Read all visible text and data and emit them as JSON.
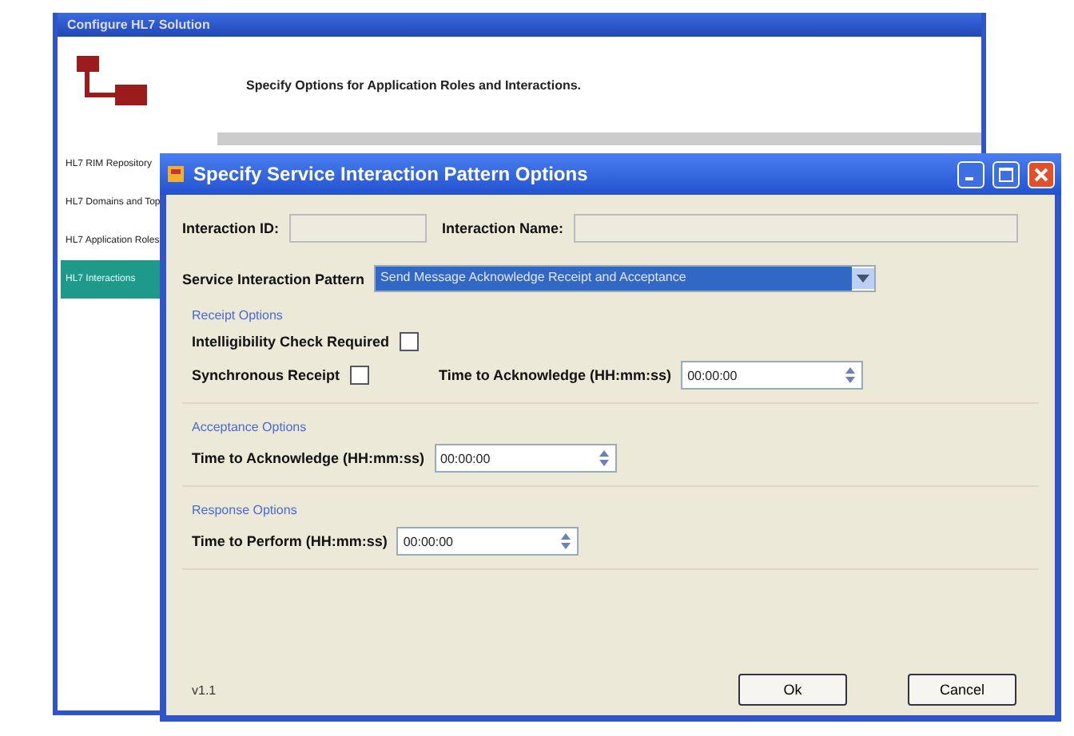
{
  "background_window": {
    "title": "Configure HL7 Solution",
    "heading": "Specify Options for Application Roles and Interactions.",
    "sidebar": {
      "items": [
        {
          "label": "HL7 RIM Repository",
          "selected": false
        },
        {
          "label": "HL7 Domains and Top",
          "selected": false
        },
        {
          "label": "HL7 Application Roles",
          "selected": false
        },
        {
          "label": "HL7 Interactions",
          "selected": true
        }
      ]
    }
  },
  "dialog": {
    "title": "Specify Service Interaction Pattern Options",
    "interaction_id": {
      "label": "Interaction ID:",
      "disabled": true
    },
    "interaction_name": {
      "label": "Interaction Name:",
      "disabled": true
    },
    "pattern": {
      "label": "Service Interaction Pattern",
      "value": "Send Message Acknowledge Receipt and Acceptance"
    },
    "groups": [
      {
        "title": "Receipt Options",
        "rows": [
          {
            "kind": "checkbox",
            "label": "Intelligibility Check Required",
            "checked": false
          },
          {
            "kind": "checkbox-time",
            "label": "Synchronous Receipt",
            "checked": false,
            "time_label": "Time to Acknowledge (HH:mm:ss)",
            "value": "00:00:00"
          }
        ]
      },
      {
        "title": "Acceptance Options",
        "rows": [
          {
            "kind": "time",
            "label": "Time to Acknowledge (HH:mm:ss)",
            "value": "00:00:00"
          }
        ]
      },
      {
        "title": "Response Options",
        "rows": [
          {
            "kind": "time",
            "label": "Time to Perform (HH:mm:ss)",
            "value": "00:00:00"
          }
        ]
      }
    ],
    "version": "v1.1",
    "buttons": [
      "Ok",
      "Cancel"
    ]
  }
}
